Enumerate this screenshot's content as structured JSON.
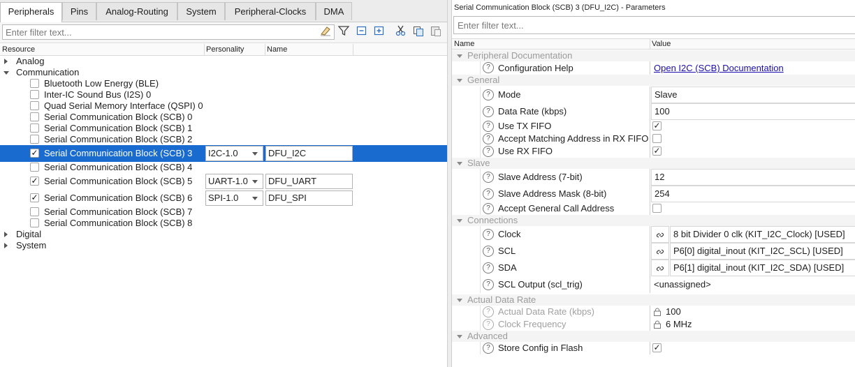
{
  "left_tabs": [
    "Peripherals",
    "Pins",
    "Analog-Routing",
    "System",
    "Peripheral-Clocks",
    "DMA"
  ],
  "left_filter": {
    "placeholder": "Enter filter text..."
  },
  "toolbar_icons": [
    "eraser-icon",
    "filter-icon",
    "collapse-all-icon",
    "expand-all-icon",
    "cut-icon",
    "copy-icon",
    "paste-icon"
  ],
  "left_columns": {
    "resource": "Resource",
    "personality": "Personality",
    "name": "Name"
  },
  "tree": {
    "analog": "Analog",
    "communication": "Communication",
    "digital": "Digital",
    "system": "System",
    "items": [
      {
        "label": "Bluetooth Low Energy (BLE)",
        "checked": false
      },
      {
        "label": "Inter-IC Sound Bus (I2S) 0",
        "checked": false
      },
      {
        "label": "Quad Serial Memory Interface (QSPI) 0",
        "checked": false
      },
      {
        "label": "Serial Communication Block (SCB) 0",
        "checked": false
      },
      {
        "label": "Serial Communication Block (SCB) 1",
        "checked": false
      },
      {
        "label": "Serial Communication Block (SCB) 2",
        "checked": false
      },
      {
        "label": "Serial Communication Block (SCB) 3",
        "checked": true,
        "personality": "I2C-1.0",
        "name": "DFU_I2C",
        "selected": true
      },
      {
        "label": "Serial Communication Block (SCB) 4",
        "checked": false
      },
      {
        "label": "Serial Communication Block (SCB) 5",
        "checked": true,
        "personality": "UART-1.0",
        "name": "DFU_UART"
      },
      {
        "label": "Serial Communication Block (SCB) 6",
        "checked": true,
        "personality": "SPI-1.0",
        "name": "DFU_SPI"
      },
      {
        "label": "Serial Communication Block (SCB) 7",
        "checked": false
      },
      {
        "label": "Serial Communication Block (SCB) 8",
        "checked": false
      }
    ]
  },
  "params": {
    "title": "Serial Communication Block (SCB) 3 (DFU_I2C) - Parameters",
    "filter_placeholder": "Enter filter text...",
    "col_name": "Name",
    "col_value": "Value",
    "cat_peripheral_doc": "Peripheral Documentation",
    "config_help": "Configuration Help",
    "config_help_link": "Open I2C (SCB) Documentation",
    "cat_general": "General",
    "mode": "Mode",
    "mode_value": "Slave",
    "data_rate": "Data Rate (kbps)",
    "data_rate_value": "100",
    "use_tx_fifo": "Use TX FIFO",
    "use_tx_fifo_checked": true,
    "accept_matching": "Accept Matching Address in RX FIFO",
    "accept_matching_checked": false,
    "use_rx_fifo": "Use RX FIFO",
    "use_rx_fifo_checked": true,
    "cat_slave": "Slave",
    "slave_address": "Slave Address (7-bit)",
    "slave_address_value": "12",
    "slave_mask": "Slave Address Mask (8-bit)",
    "slave_mask_value": "254",
    "accept_general": "Accept General Call Address",
    "accept_general_checked": false,
    "cat_connections": "Connections",
    "clock": "Clock",
    "clock_value": "8 bit Divider 0 clk (KIT_I2C_Clock) [USED]",
    "scl": "SCL",
    "scl_value": "P6[0] digital_inout (KIT_I2C_SCL) [USED]",
    "sda": "SDA",
    "sda_value": "P6[1] digital_inout (KIT_I2C_SDA) [USED]",
    "scl_output": "SCL Output (scl_trig)",
    "scl_output_value": "<unassigned>",
    "cat_actual_rate": "Actual Data Rate",
    "actual_rate": "Actual Data Rate (kbps)",
    "actual_rate_value": "100",
    "clock_freq": "Clock Frequency",
    "clock_freq_value": "6 MHz",
    "cat_advanced": "Advanced",
    "store_config": "Store Config in Flash",
    "store_config_checked": true
  },
  "glyphs": {
    "check": "✓",
    "question": "?",
    "link": "🔗"
  }
}
